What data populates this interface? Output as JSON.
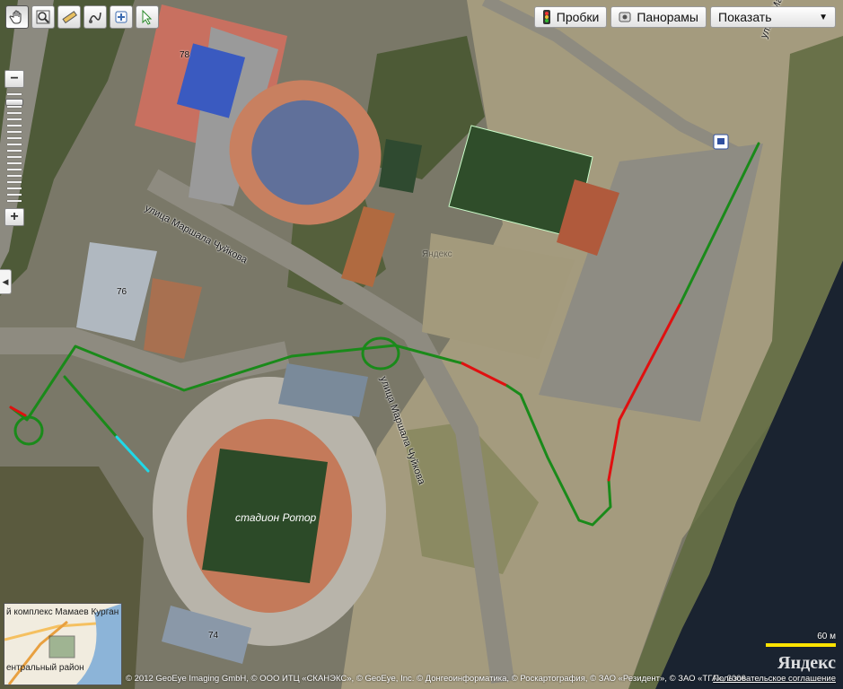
{
  "toolbar": {
    "tools": [
      "hand-icon",
      "magnifier-icon",
      "ruler-icon",
      "route-icon",
      "add-point-icon",
      "pointer-icon"
    ]
  },
  "top_buttons": {
    "traffic": "Пробки",
    "panoramas": "Панорамы",
    "show": "Показать",
    "show_arrow": "▼"
  },
  "zoom": {
    "plus": "+",
    "minus": "−",
    "level": 0.93
  },
  "map_labels": {
    "street_top_right": "улица Маршала Чуйкова",
    "street_left": "улица Маршала Чуйкова",
    "street_center": "улица Маршала Чуйкова",
    "stadium": "стадион Ротор",
    "watermark": "Яндекс"
  },
  "building_numbers": {
    "pool": "78",
    "arena": "76",
    "south": "74"
  },
  "minimap": {
    "label_top": "й комплекс Мамаев Курган",
    "label_bottom": "ентральный район"
  },
  "copyright": "© 2012 GeoEye Imaging GmbH, © ООО ИТЦ «СКАНЭКС», © GeoEye, Inc. © Донгеоинформатика, © Роскартография, © ЗАО «Резидент», © ЗАО «ТГА», 2006",
  "agreement_link": "Пользовательское соглашение",
  "scale": {
    "label": "60 м"
  },
  "logo": "Яндекс",
  "colors": {
    "route_green": "#1a8a1a",
    "route_red": "#e01010",
    "route_cyan": "#20d8e8",
    "scale_yellow": "#ffe300",
    "river": "#1a2330"
  }
}
